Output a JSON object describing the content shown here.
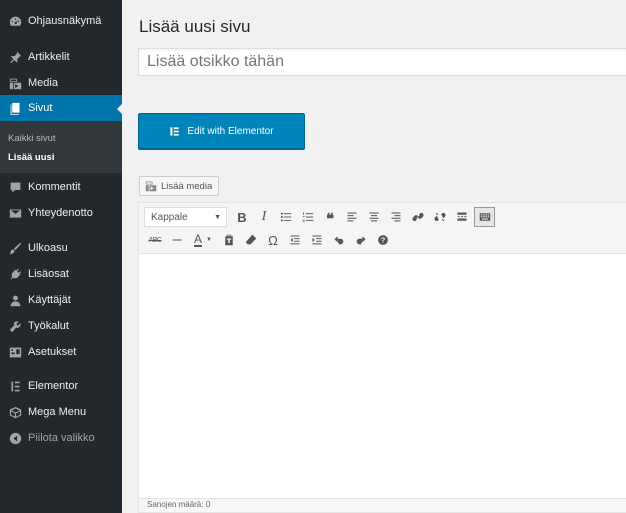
{
  "sidebar": {
    "items": [
      {
        "label": "Ohjausnäkymä",
        "icon": "dashboard-icon"
      },
      {
        "label": "Artikkelit",
        "icon": "pin-icon"
      },
      {
        "label": "Media",
        "icon": "media-icon"
      },
      {
        "label": "Sivut",
        "icon": "pages-icon",
        "current": true
      },
      {
        "label": "Kommentit",
        "icon": "comment-icon"
      },
      {
        "label": "Yhteydenotto",
        "icon": "mail-icon"
      },
      {
        "label": "Ulkoasu",
        "icon": "brush-icon"
      },
      {
        "label": "Lisäosat",
        "icon": "plugin-icon"
      },
      {
        "label": "Käyttäjät",
        "icon": "user-icon"
      },
      {
        "label": "Työkalut",
        "icon": "wrench-icon"
      },
      {
        "label": "Asetukset",
        "icon": "settings-icon"
      },
      {
        "label": "Elementor",
        "icon": "elementor-icon"
      },
      {
        "label": "Mega Menu",
        "icon": "cube-icon"
      },
      {
        "label": "Piilota valikko",
        "icon": "collapse-icon"
      }
    ],
    "submenu": [
      {
        "label": "Kaikki sivut"
      },
      {
        "label": "Lisää uusi",
        "current": true
      }
    ]
  },
  "main": {
    "page_title": "Lisää uusi sivu",
    "title_placeholder": "Lisää otsikko tähän",
    "elementor_button": "Edit with Elementor",
    "add_media_button": "Lisää media"
  },
  "editor": {
    "format_select": "Kappale",
    "status_bar": "Sanojen määrä: 0",
    "toolbar_row1": [
      "bold-button",
      "italic-button",
      "bullet-list-button",
      "numbered-list-button",
      "blockquote-button",
      "align-left-button",
      "align-center-button",
      "align-right-button",
      "insert-link-button",
      "remove-link-button",
      "read-more-button",
      "toolbar-toggle-button"
    ],
    "toolbar_row2": [
      "strikethrough-button",
      "horizontal-line-button",
      "text-color-button",
      "paste-as-text-button",
      "clear-formatting-button",
      "special-character-button",
      "outdent-button",
      "indent-button",
      "undo-button",
      "redo-button",
      "help-button"
    ]
  },
  "colors": {
    "sidebar_bg": "#23282d",
    "accent": "#0073aa",
    "elementor_btn": "#0085ba"
  }
}
